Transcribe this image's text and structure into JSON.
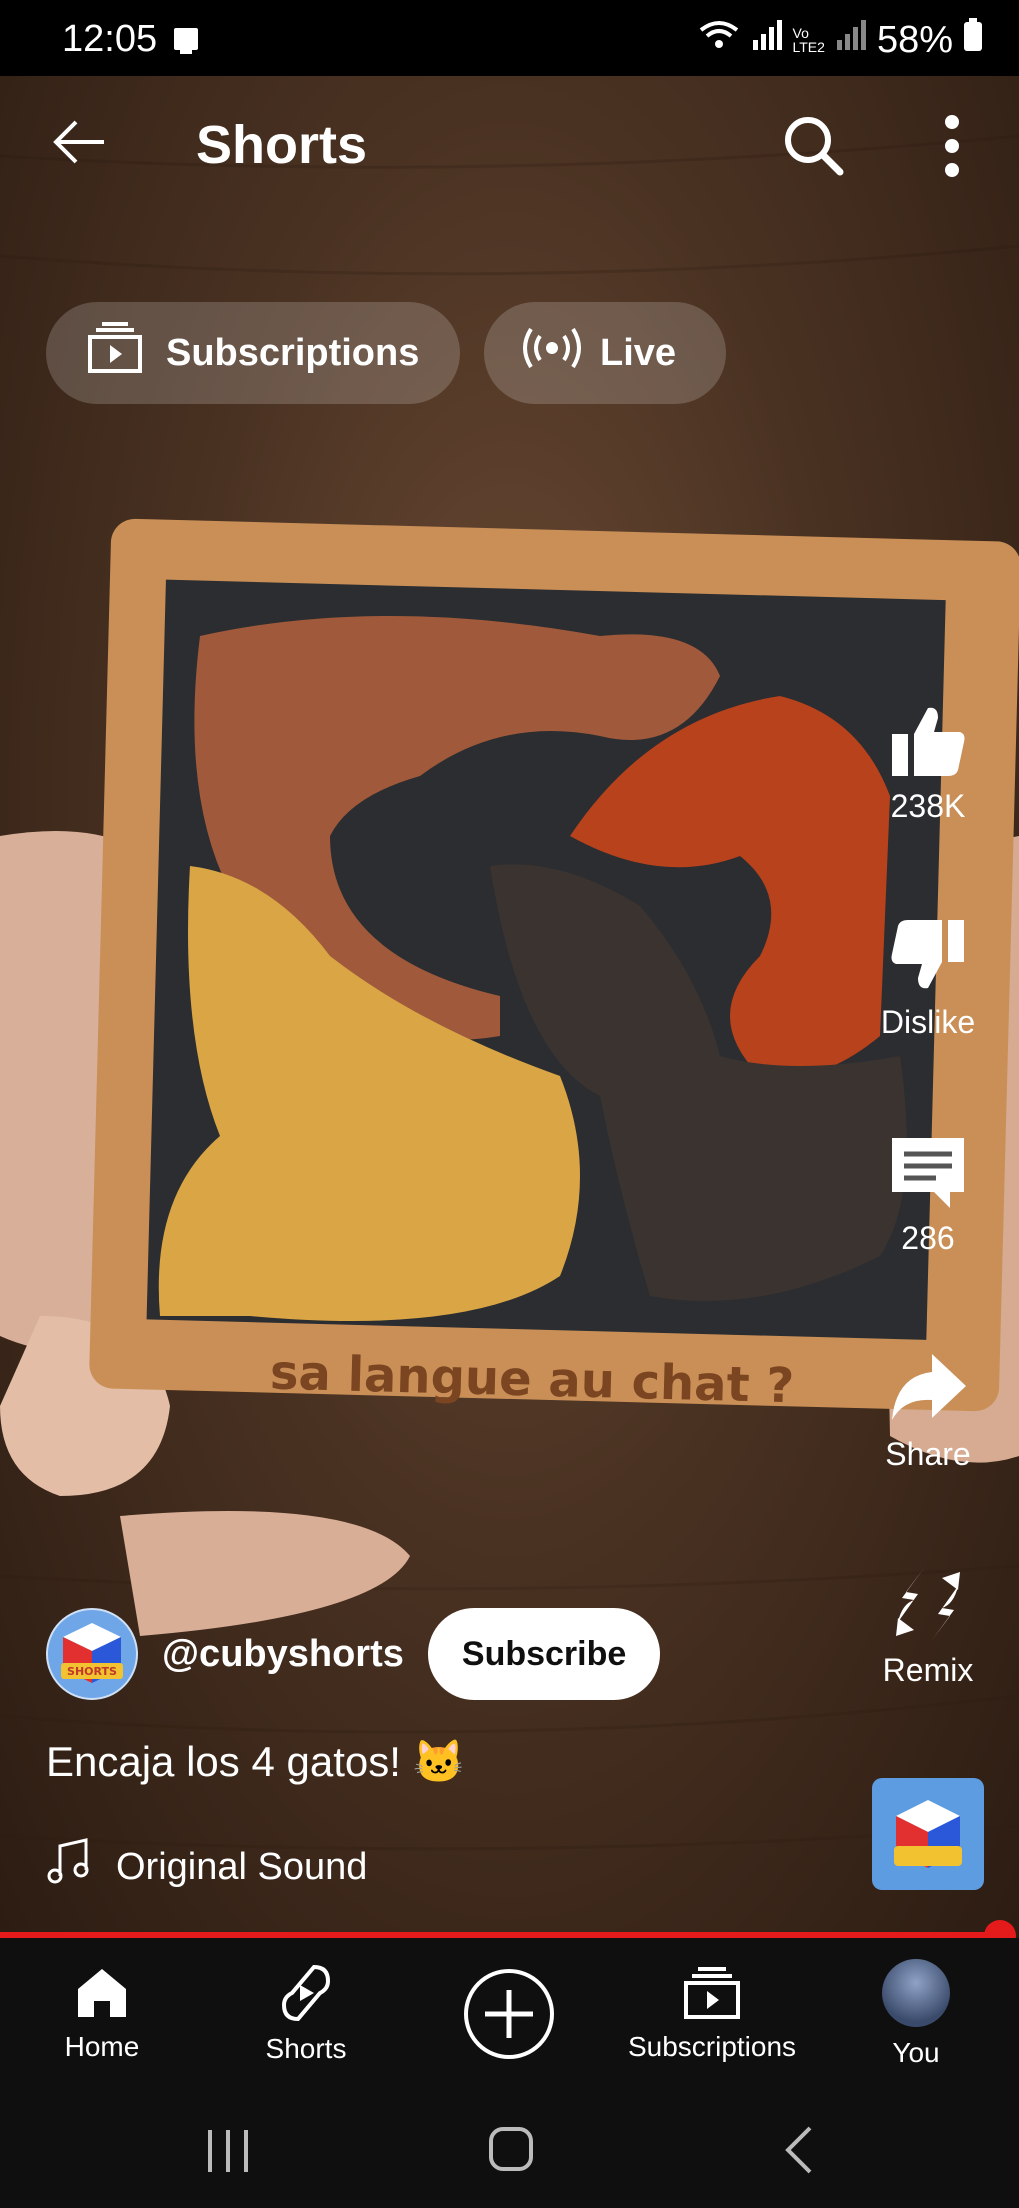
{
  "status": {
    "time": "12:05",
    "battery": "58%"
  },
  "header": {
    "title": "Shorts"
  },
  "chips": {
    "subscriptions": "Subscriptions",
    "live": "Live"
  },
  "video": {
    "overlay_text": "sa langue au chat ?"
  },
  "actions": {
    "like_count": "238K",
    "dislike_label": "Dislike",
    "comment_count": "286",
    "share_label": "Share",
    "remix_label": "Remix"
  },
  "channel": {
    "handle": "@cubyshorts",
    "subscribe_label": "Subscribe",
    "avatar_text": "SHORTS"
  },
  "caption": "Encaja los 4 gatos! 🐱",
  "sound": {
    "label": "Original Sound"
  },
  "playback": {
    "progress_fraction": 0.98
  },
  "nav": {
    "home": "Home",
    "shorts": "Shorts",
    "subscriptions": "Subscriptions",
    "you": "You"
  },
  "colors": {
    "accent_red": "#e51b1b",
    "nav_bg": "#0f0f0f"
  }
}
